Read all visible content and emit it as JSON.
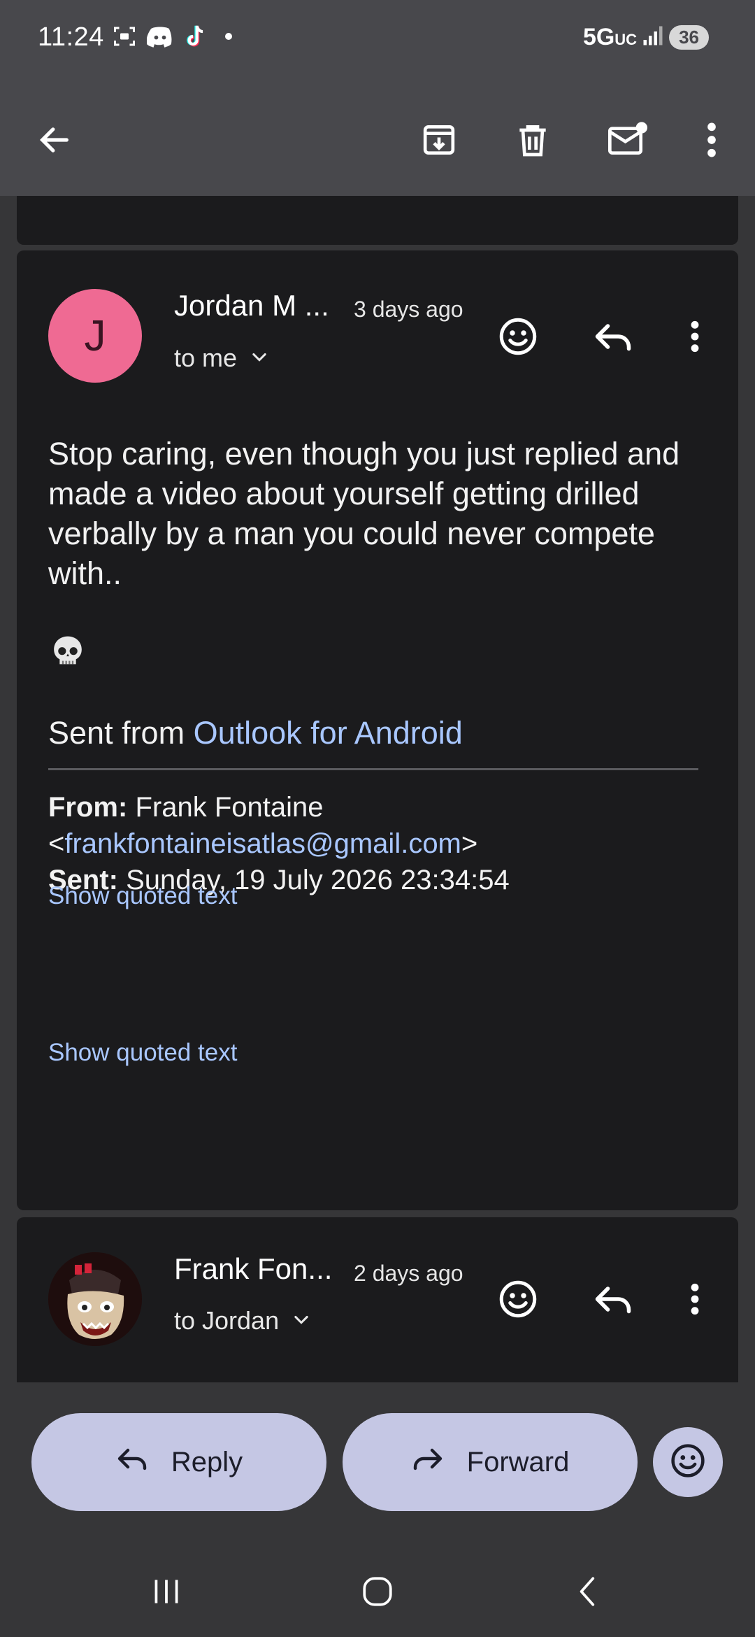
{
  "status_bar": {
    "time": "11:24",
    "network": "5G",
    "network_suffix": "UC",
    "battery": "36",
    "icons": [
      "screenshot-icon",
      "discord-icon",
      "tiktok-icon",
      "dot-icon",
      "signal-icon"
    ]
  },
  "app_bar": {
    "icons": [
      "back-arrow-icon",
      "archive-icon",
      "delete-icon",
      "mark-unread-icon",
      "more-vert-icon"
    ]
  },
  "message1": {
    "avatar_letter": "J",
    "avatar_color": "#ef6a93",
    "sender": "Jordan M ...",
    "time": "3 days ago",
    "recipient": "to me",
    "body": "Stop caring, even though you just replied and made a video about yourself getting drilled verbally by a man you could never compete with..",
    "emoji": "skull-emoji",
    "sent_from_prefix": "Sent from ",
    "sent_from_link": "Outlook for Android",
    "from_label": "From:",
    "from_name": "Frank Fontaine",
    "from_email": "frankfontaineisatlas@gmail.com",
    "sent_label": "Sent:",
    "sent_value": "Sunday, 19 July 2026 23:34:54",
    "show_quoted_1": "Show quoted text",
    "show_quoted_2": "Show quoted text"
  },
  "message2": {
    "sender": "Frank Fon...",
    "time": "2 days ago",
    "recipient": "to Jordan"
  },
  "bottom_actions": {
    "reply_label": "Reply",
    "forward_label": "Forward"
  },
  "colors": {
    "link": "#a9c7ff",
    "pill": "#c5c7e4",
    "card": "#1b1b1d",
    "app_bar": "#48484c"
  }
}
